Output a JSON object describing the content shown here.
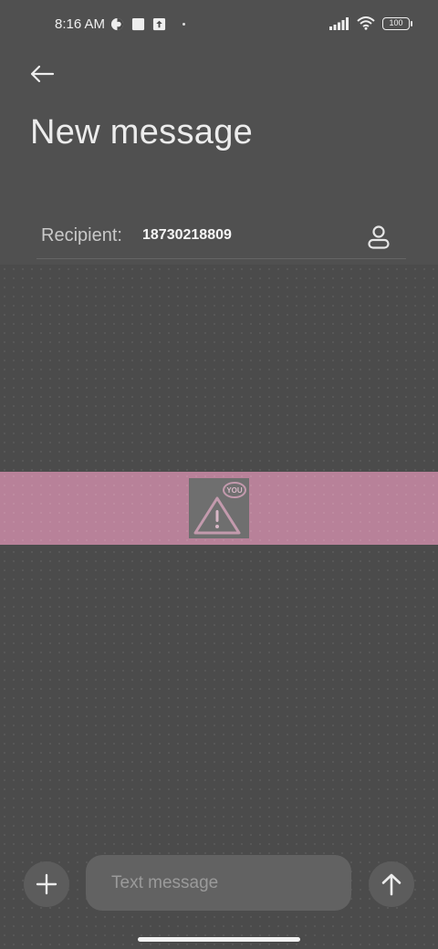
{
  "status_bar": {
    "time": "8:16 AM",
    "battery": "100",
    "icons": [
      "circle-half-icon",
      "square-icon",
      "upload-icon",
      "dot-icon",
      "signal-icon",
      "wifi-icon",
      "battery-icon"
    ]
  },
  "header": {
    "back_icon": "back-arrow-icon",
    "title": "New message"
  },
  "recipient": {
    "label": "Recipient:",
    "value": "18730218809",
    "contact_icon": "person-icon"
  },
  "banner": {
    "badge": "YOU",
    "icon": "warning-triangle-icon",
    "color": "#b88199"
  },
  "composer": {
    "add_icon": "plus-icon",
    "placeholder": "Text message",
    "value": "",
    "send_icon": "arrow-up-icon"
  }
}
